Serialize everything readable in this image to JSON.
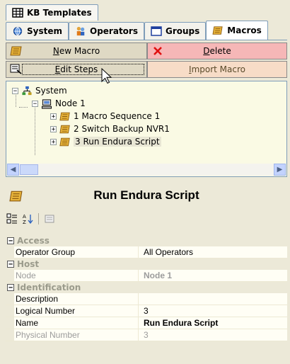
{
  "tabs_top": [
    {
      "label": "KB Templates",
      "icon": "table-grid-icon"
    }
  ],
  "tabs_row2": [
    {
      "label": "System",
      "icon": "system-network-icon",
      "active": false
    },
    {
      "label": "Operators",
      "icon": "operators-users-icon",
      "active": false
    },
    {
      "label": "Groups",
      "icon": "window-groups-icon",
      "active": false
    },
    {
      "label": "Macros",
      "icon": "macro-scroll-icon",
      "active": true
    }
  ],
  "buttons": {
    "new_macro": {
      "prefix": "",
      "underline": "N",
      "rest": "ew Macro",
      "icon": "macro-scroll-icon"
    },
    "delete": {
      "prefix": "",
      "underline": "D",
      "rest": "elete",
      "icon": "red-x-icon"
    },
    "edit_steps": {
      "prefix": "",
      "underline": "E",
      "rest": "dit Steps",
      "icon": "edit-steps-icon"
    },
    "import_macro": {
      "prefix": "",
      "underline": "I",
      "rest": "mport Macro"
    }
  },
  "tree": {
    "root": "System",
    "node": "Node 1",
    "items": [
      "1 Macro Sequence 1",
      "2 Switch Backup NVR1",
      "3 Run Endura Script"
    ],
    "selected_index": 2
  },
  "selected_title": "Run Endura Script",
  "toolbar": {
    "categorized": "categorized-icon",
    "alphabetical": "sort-az-icon",
    "pages": "property-pages-icon"
  },
  "properties": [
    {
      "category": "Access",
      "rows": [
        {
          "name": "Operator Group",
          "value": "All Operators",
          "readonly": false,
          "bold": false
        }
      ]
    },
    {
      "category": "Host",
      "rows": [
        {
          "name": "Node",
          "value": "Node 1",
          "readonly": true,
          "bold": true
        }
      ]
    },
    {
      "category": "Identification",
      "rows": [
        {
          "name": "Description",
          "value": "",
          "readonly": false,
          "bold": false
        },
        {
          "name": "Logical Number",
          "value": "3",
          "readonly": false,
          "bold": false
        },
        {
          "name": "Name",
          "value": "Run Endura Script",
          "readonly": false,
          "bold": true
        },
        {
          "name": "Physical Number",
          "value": "3",
          "readonly": true,
          "bold": false
        }
      ]
    }
  ],
  "colors": {
    "accent": "#7f9db9",
    "delete_bg": "#f6b7b7",
    "import_bg": "#f7dcc7",
    "panel_bg": "#ece9d8"
  }
}
